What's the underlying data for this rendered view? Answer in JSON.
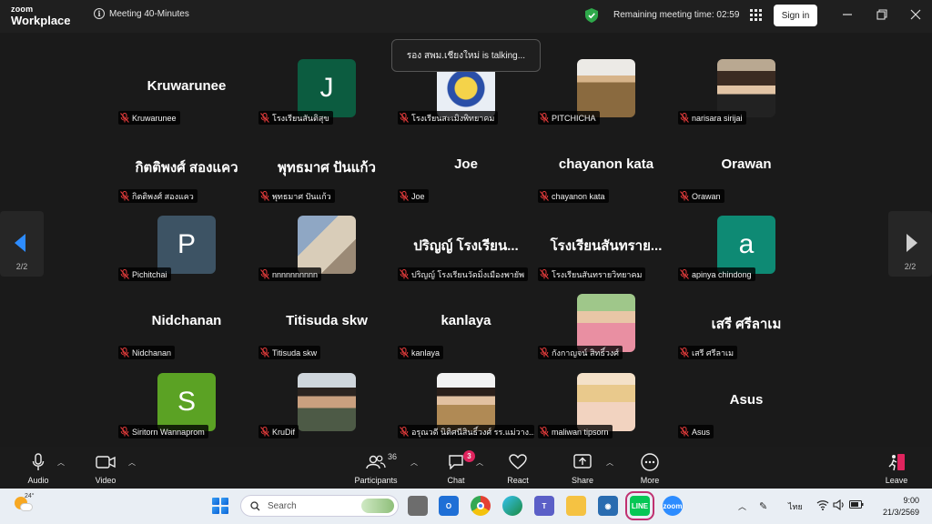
{
  "titlebar": {
    "brand_top": "zoom",
    "brand_bottom": "Workplace",
    "meeting_name": "Meeting 40-Minutes",
    "remaining_time": "Remaining meeting time: 02:59",
    "signin_label": "Sign in",
    "shield_color": "#2ea84a"
  },
  "talking_banner": "รอง สพม.เชียงใหม่ is talking...",
  "pagination": {
    "left_page": "2/2",
    "right_page": "2/2",
    "arrow_color": "#2d8cff"
  },
  "participants": [
    {
      "display": "Kruwarunee",
      "label": "Kruwarunee",
      "kind": "name"
    },
    {
      "display": "J",
      "label": "โรงเรียนสันติสุข",
      "kind": "letter",
      "color": "#0c5c40"
    },
    {
      "display": "",
      "label": "โรงเรียนสะเมิงพิทยาคม",
      "kind": "photo",
      "photo": "school-logo"
    },
    {
      "display": "",
      "label": "PITCHICHA",
      "kind": "photo",
      "photo": "person-uniform"
    },
    {
      "display": "",
      "label": "narisara sirijai",
      "kind": "photo",
      "photo": "person-dark"
    },
    {
      "display": "กิตติพงศ์ สองแคว",
      "label": "กิตติพงศ์ สองแคว",
      "kind": "name"
    },
    {
      "display": "พุทธมาศ ปันแก้ว",
      "label": "พุทธมาศ ปันแก้ว",
      "kind": "name"
    },
    {
      "display": "Joe",
      "label": "Joe",
      "kind": "name"
    },
    {
      "display": "chayanon kata",
      "label": "chayanon kata",
      "kind": "name"
    },
    {
      "display": "Orawan",
      "label": "Orawan",
      "kind": "name"
    },
    {
      "display": "P",
      "label": "Pichitchai",
      "kind": "letter",
      "color": "#3d5364"
    },
    {
      "display": "",
      "label": "nnnnnnnnnn",
      "kind": "photo",
      "photo": "cat"
    },
    {
      "display": "ปริญญ์ โรงเรียน...",
      "label": "ปริญญ์ โรงเรียนวัดมิ่งเมืองพายัพ",
      "kind": "name"
    },
    {
      "display": "โรงเรียนสันทราย...",
      "label": "โรงเรียนสันทรายวิทยาคม",
      "kind": "name"
    },
    {
      "display": "a",
      "label": "apinya chindong",
      "kind": "letter",
      "color": "#0e8a74"
    },
    {
      "display": "Nidchanan",
      "label": "Nidchanan",
      "kind": "name"
    },
    {
      "display": "Titisuda skw",
      "label": "Titisuda skw",
      "kind": "name"
    },
    {
      "display": "kanlaya",
      "label": "kanlaya",
      "kind": "name"
    },
    {
      "display": "",
      "label": "กังกาญจน์ สิทธิ์วงศ์",
      "kind": "photo",
      "photo": "person-green"
    },
    {
      "display": "เสรี ศรีลาเม",
      "label": "เสรี ศรีลาเม",
      "kind": "name"
    },
    {
      "display": "S",
      "label": "Siritorn Wannaprom",
      "kind": "letter",
      "color": "#5ba224"
    },
    {
      "display": "",
      "label": "KruDif",
      "kind": "photo",
      "photo": "person-man"
    },
    {
      "display": "",
      "label": "อรุณวดี นิติศนีสินธิ์วงศ์ รร.แม่วาง...",
      "kind": "photo",
      "photo": "person-uniform2"
    },
    {
      "display": "",
      "label": "maliwan tipsorn",
      "kind": "photo",
      "photo": "person-blonde"
    },
    {
      "display": "Asus",
      "label": "Asus",
      "kind": "name"
    }
  ],
  "toolbar": {
    "audio": "Audio",
    "video": "Video",
    "participants": "Participants",
    "participants_count": "36",
    "chat": "Chat",
    "chat_badge": "3",
    "react": "React",
    "share": "Share",
    "more": "More",
    "leave": "Leave"
  },
  "taskbar": {
    "temperature": "24°",
    "search_placeholder": "Search",
    "language": "ไทย",
    "time": "9:00",
    "date": "21/3/2569"
  }
}
